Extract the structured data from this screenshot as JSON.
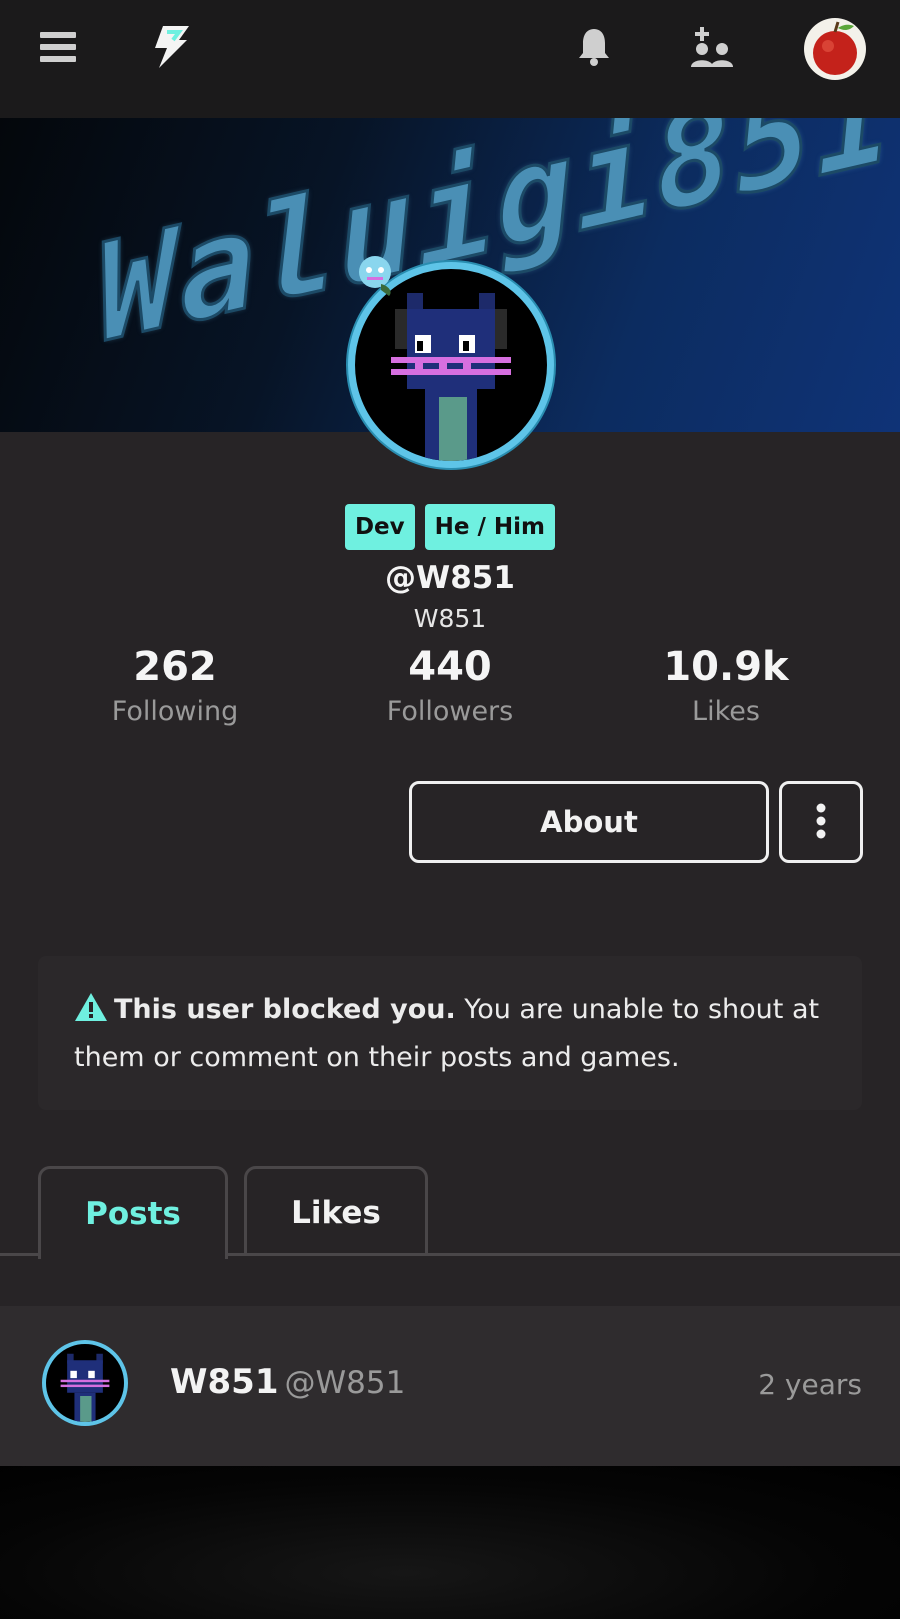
{
  "topbar": {
    "menu_icon": "hamburger-menu-icon",
    "logo_icon": "lightning-logo-icon",
    "notifications_icon": "bell-icon",
    "friends_icon": "add-friend-icon",
    "user_avatar": "apple-avatar"
  },
  "banner": {
    "text": "Waluigi851"
  },
  "profile": {
    "badges": [
      "Dev",
      "He / Him"
    ],
    "handle": "@W851",
    "display_name": "W851",
    "stats": [
      {
        "value": "262",
        "label": "Following"
      },
      {
        "value": "440",
        "label": "Followers"
      },
      {
        "value": "10.9k",
        "label": "Likes"
      }
    ],
    "about_label": "About",
    "more_icon": "vertical-dots-icon"
  },
  "notice": {
    "icon": "warning-icon",
    "bold": "This user blocked you.",
    "text": " You are unable to shout at them or comment on their posts and games."
  },
  "tabs": [
    {
      "label": "Posts",
      "active": true
    },
    {
      "label": "Likes",
      "active": false
    }
  ],
  "post": {
    "author": "W851",
    "handle": "@W851",
    "time": "2 years"
  },
  "colors": {
    "accent": "#6ff0e0",
    "background": "#272426",
    "topbar": "#1b1a1b",
    "avatar_ring": "#5ec4e8"
  }
}
